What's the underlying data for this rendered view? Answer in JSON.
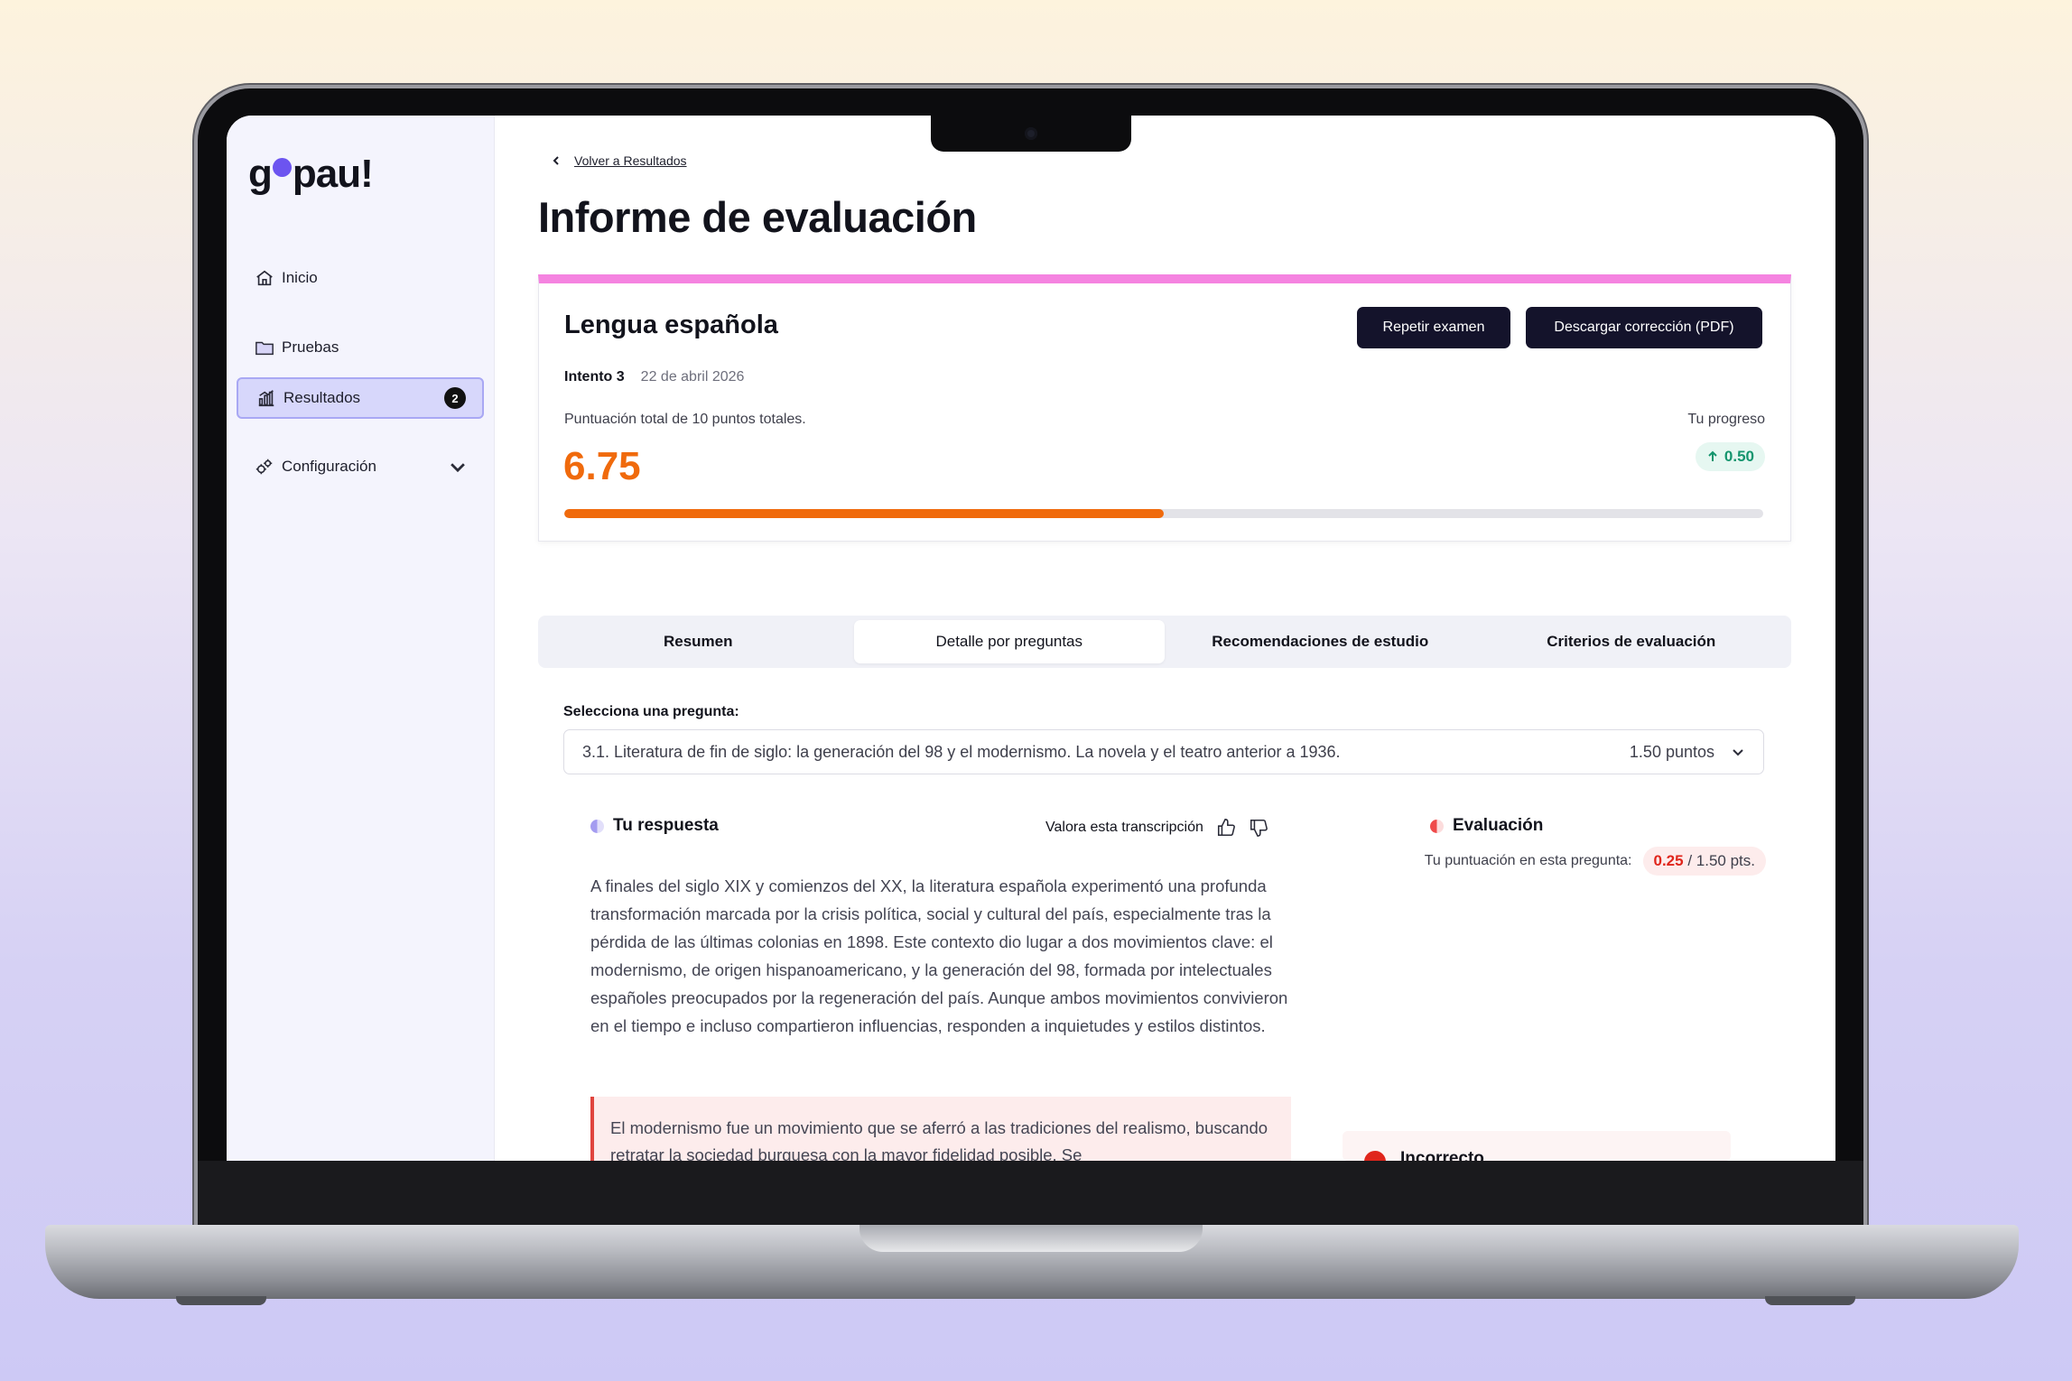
{
  "brand": {
    "logo": "gopau!"
  },
  "sidebar": {
    "items": [
      {
        "label": "Inicio",
        "icon": "home-icon"
      },
      {
        "label": "Pruebas",
        "icon": "folder-icon"
      },
      {
        "label": "Resultados",
        "icon": "chart-icon",
        "badge": "2",
        "active": true
      },
      {
        "label": "Configuración",
        "icon": "gears-icon",
        "expandable": true
      }
    ]
  },
  "header": {
    "back_link": "Volver a Resultados",
    "title": "Informe de evaluación"
  },
  "card": {
    "subject": "Lengua española",
    "repeat_button": "Repetir examen",
    "download_button": "Descargar corrección (PDF)",
    "attempt_label": "Intento 3",
    "attempt_date": "22 de abril 2026",
    "score_label": "Puntuación total de 10 puntos totales.",
    "score": "6.75",
    "progress_label": "Tu progreso",
    "progress_delta": "0.50",
    "score_bar_fraction": 0.5,
    "accent_color": "#f06a0c",
    "top_border_color": "#f583e0"
  },
  "tabs": [
    {
      "label": "Resumen"
    },
    {
      "label": "Detalle por preguntas",
      "active": true
    },
    {
      "label": "Recomendaciones de estudio"
    },
    {
      "label": "Criterios de evaluación"
    }
  ],
  "question_select": {
    "label": "Selecciona una pregunta:",
    "selected": "3.1. Literatura de fin de siglo: la generación del 98 y el modernismo. La novela y el teatro anterior a 1936.",
    "points": "1.50 puntos"
  },
  "answer": {
    "heading": "Tu respuesta",
    "rate_label": "Valora esta transcripción",
    "text": "A finales del siglo XIX y comienzos del XX, la literatura española experimentó una profunda transformación marcada por la crisis política, social y cultural del país, especialmente tras la pérdida de las últimas colonias en 1898. Este contexto dio lugar a dos movimientos clave: el modernismo, de origen hispanoamericano, y la generación del 98, formada por intelectuales españoles preocupados por la regeneración del país. Aunque ambos movimientos convivieron en el tiempo e incluso compartieron influencias, responden a inquietudes y estilos distintos.",
    "incorrect_fragment": "El modernismo fue un movimiento que se aferró a las tradiciones del realismo, buscando retratar la sociedad burguesa con la mayor fidelidad posible. Se"
  },
  "evaluation": {
    "heading": "Evaluación",
    "score_label": "Tu puntuación en esta pregunta:",
    "score": "0.25",
    "max": "/ 1.50 pts.",
    "verdict": "Incorrecto"
  }
}
